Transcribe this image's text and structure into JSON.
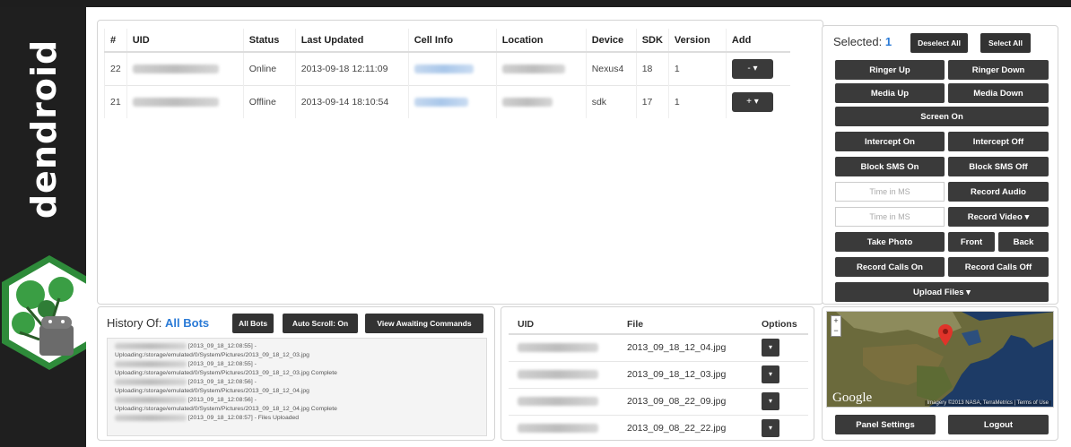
{
  "brand": "dendroid",
  "bots_table": {
    "columns": [
      "#",
      "UID",
      "Status",
      "Last Updated",
      "Cell Info",
      "Location",
      "Device",
      "SDK",
      "Version",
      "Add"
    ],
    "rows": [
      {
        "num": "22",
        "status": "Online",
        "updated": "2013-09-18 12:11:09",
        "device": "Nexus4",
        "sdk": "18",
        "version": "1",
        "add": "-  ▾"
      },
      {
        "num": "21",
        "status": "Offline",
        "updated": "2013-09-14 18:10:54",
        "device": "sdk",
        "sdk": "17",
        "version": "1",
        "add": "+  ▾"
      }
    ]
  },
  "selected": {
    "label": "Selected:",
    "count": "1",
    "deselect_all": "Deselect All",
    "select_all": "Select All"
  },
  "controls": {
    "ringer_up": "Ringer Up",
    "ringer_down": "Ringer Down",
    "media_up": "Media Up",
    "media_down": "Media Down",
    "screen_on": "Screen On",
    "intercept_on": "Intercept On",
    "intercept_off": "Intercept Off",
    "block_sms_on": "Block SMS On",
    "block_sms_off": "Block SMS Off",
    "time_placeholder_1": "Time in MS",
    "record_audio": "Record Audio",
    "time_placeholder_2": "Time in MS",
    "record_video": "Record Video ▾",
    "take_photo": "Take Photo",
    "front": "Front",
    "back": "Back",
    "record_calls_on": "Record Calls On",
    "record_calls_off": "Record Calls Off",
    "upload_files": "Upload Files ▾"
  },
  "history": {
    "label": "History Of:",
    "target": "All Bots",
    "all_bots_btn": "All Bots",
    "auto_scroll_btn": "Auto Scroll: On",
    "awaiting_btn": "View Awaiting Commands",
    "log": [
      "[2013_09_18_12:08:55] -",
      "Uploading:/storage/emulated/0/System/Pictures/2013_09_18_12_03.jpg",
      "[2013_09_18_12:08:55] -",
      "Uploading:/storage/emulated/0/System/Pictures/2013_09_18_12_03.jpg Complete",
      "[2013_09_18_12:08:56] -",
      "Uploading:/storage/emulated/0/System/Pictures/2013_09_18_12_04.jpg",
      "[2013_09_18_12:08:56] -",
      "Uploading:/storage/emulated/0/System/Pictures/2013_09_18_12_04.jpg Complete",
      "[2013_09_18_12:08:57] - Files Uploaded"
    ]
  },
  "files_table": {
    "columns": [
      "UID",
      "File",
      "Options"
    ],
    "rows": [
      "2013_09_18_12_04.jpg",
      "2013_09_18_12_03.jpg",
      "2013_09_08_22_09.jpg",
      "2013_09_08_22_22.jpg"
    ]
  },
  "map": {
    "zoom_in": "+",
    "zoom_out": "−",
    "logo": "Google",
    "attribution": "Imagery ©2013 NASA, TerraMetrics",
    "terms": "Terms of Use"
  },
  "footer": {
    "panel_settings": "Panel Settings",
    "logout": "Logout"
  }
}
